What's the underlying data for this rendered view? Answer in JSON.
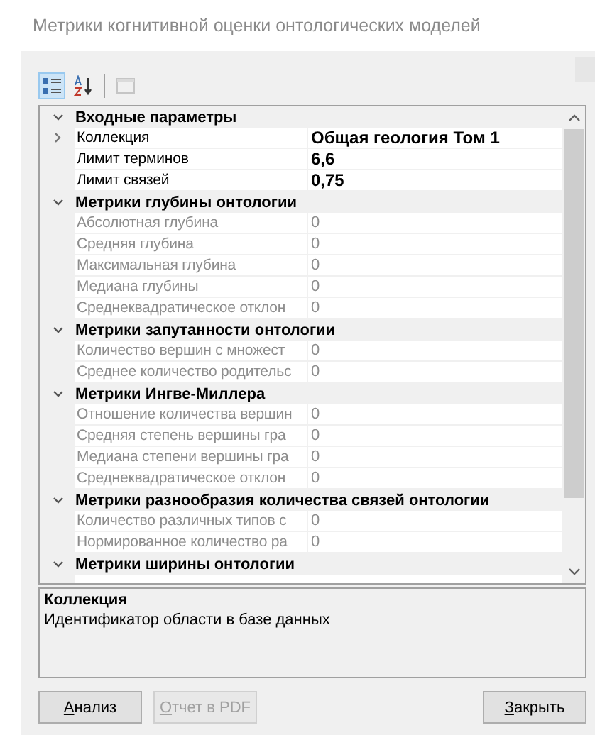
{
  "window": {
    "title": "Метрики когнитивной оценки онтологических моделей"
  },
  "toolbar": [
    {
      "kind": "categorized",
      "selected": true,
      "disabled": false
    },
    {
      "kind": "alphabetical",
      "selected": false,
      "disabled": false
    },
    {
      "kind": "pages",
      "selected": false,
      "disabled": true
    }
  ],
  "categories": [
    {
      "name": "Входные параметры",
      "expanded": true,
      "items": [
        {
          "name": "Коллекция",
          "value": "Общая геология Том 1",
          "disabled": false,
          "expandable": true
        },
        {
          "name": "Лимит терминов",
          "value": "6,6",
          "disabled": false,
          "expandable": false
        },
        {
          "name": "Лимит связей",
          "value": "0,75",
          "disabled": false,
          "expandable": false
        }
      ]
    },
    {
      "name": "Метрики глубины онтологии",
      "expanded": true,
      "items": [
        {
          "name": "Абсолютная глубина",
          "value": "0",
          "disabled": true,
          "expandable": false
        },
        {
          "name": "Средняя глубина",
          "value": "0",
          "disabled": true,
          "expandable": false
        },
        {
          "name": "Максимальная глубина",
          "value": "0",
          "disabled": true,
          "expandable": false
        },
        {
          "name": "Медиана глубины",
          "value": "0",
          "disabled": true,
          "expandable": false
        },
        {
          "name": "Среднеквадратическое отклон",
          "value": "0",
          "disabled": true,
          "expandable": false
        }
      ]
    },
    {
      "name": "Метрики запутанности онтологии",
      "expanded": true,
      "items": [
        {
          "name": "Количество вершин с множест",
          "value": "0",
          "disabled": true,
          "expandable": false
        },
        {
          "name": "Среднее количество родительс",
          "value": "0",
          "disabled": true,
          "expandable": false
        }
      ]
    },
    {
      "name": "Метрики Ингве-Миллера",
      "expanded": true,
      "items": [
        {
          "name": "Отношение количества вершин",
          "value": "0",
          "disabled": true,
          "expandable": false
        },
        {
          "name": "Средняя степень вершины гра",
          "value": "0",
          "disabled": true,
          "expandable": false
        },
        {
          "name": "Медиана степени вершины гра",
          "value": "0",
          "disabled": true,
          "expandable": false
        },
        {
          "name": "Среднеквадратическое отклон",
          "value": "0",
          "disabled": true,
          "expandable": false
        }
      ]
    },
    {
      "name": "Метрики разнообразия количества связей онтологии",
      "expanded": true,
      "items": [
        {
          "name": "Количество различных типов с",
          "value": "0",
          "disabled": true,
          "expandable": false
        },
        {
          "name": "Нормированное количество ра",
          "value": "0",
          "disabled": true,
          "expandable": false
        }
      ]
    },
    {
      "name": "Метрики ширины онтологии",
      "expanded": true
    }
  ],
  "description": {
    "title": "Коллекция",
    "text": "Идентификатор области в базе данных"
  },
  "buttons": [
    {
      "label": "Анализ",
      "disabled": false
    },
    {
      "label": "Отчет в PDF",
      "disabled": true
    },
    {
      "label": "Закрыть",
      "disabled": false
    }
  ]
}
